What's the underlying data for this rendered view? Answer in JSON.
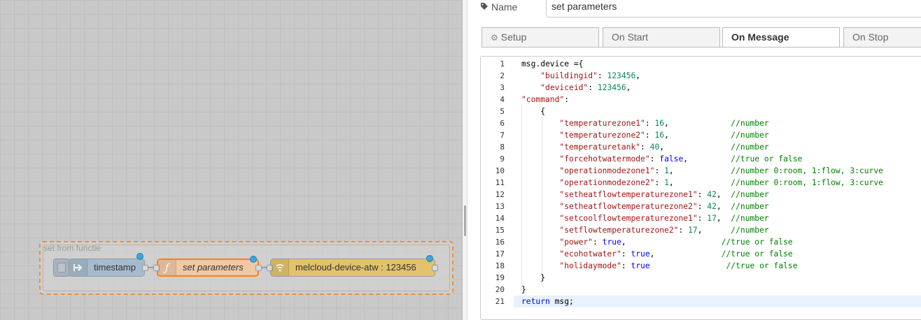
{
  "flow": {
    "group_label": "set from functie",
    "nodes": [
      {
        "label": "timestamp",
        "type": "inject"
      },
      {
        "label": "set parameters",
        "type": "function"
      },
      {
        "label": "melcloud-device-atw : 123456",
        "type": "melcloud"
      }
    ],
    "colors": {
      "inject": "#a6bbcf",
      "function": "#fdd0a2",
      "melcloud": "#e2c26c",
      "group_border": "#e8913b",
      "status_dot": "#3ea7d6"
    }
  },
  "editor": {
    "name_label": "Name",
    "name_value": "set parameters",
    "tabs": [
      {
        "label": "Setup",
        "active": false
      },
      {
        "label": "On Start",
        "active": false
      },
      {
        "label": "On Message",
        "active": true
      },
      {
        "label": "On Stop",
        "active": false
      }
    ],
    "code": {
      "line_numbers": [
        "1",
        "2",
        "3",
        "4",
        "5",
        "6",
        "7",
        "8",
        "9",
        "10",
        "11",
        "12",
        "13",
        "14",
        "15",
        "16",
        "17",
        "18",
        "19",
        "20",
        "21"
      ],
      "lines": [
        [
          {
            "t": "msg.device ={",
            "c": "plain"
          }
        ],
        [
          {
            "t": "    ",
            "c": "plain"
          },
          {
            "t": "\"buildingid\"",
            "c": "str"
          },
          {
            "t": ": ",
            "c": "plain"
          },
          {
            "t": "123456",
            "c": "num"
          },
          {
            "t": ",",
            "c": "plain"
          }
        ],
        [
          {
            "t": "    ",
            "c": "plain"
          },
          {
            "t": "\"deviceid\"",
            "c": "str"
          },
          {
            "t": ": ",
            "c": "plain"
          },
          {
            "t": "123456",
            "c": "num"
          },
          {
            "t": ",",
            "c": "plain"
          }
        ],
        [
          {
            "t": "\"command\"",
            "c": "str"
          },
          {
            "t": ":",
            "c": "plain"
          }
        ],
        [
          {
            "t": "    {",
            "c": "plain"
          }
        ],
        [
          {
            "t": "        ",
            "c": "plain"
          },
          {
            "t": "\"temperaturezone1\"",
            "c": "str"
          },
          {
            "t": ": ",
            "c": "plain"
          },
          {
            "t": "16",
            "c": "num"
          },
          {
            "t": ",             ",
            "c": "plain"
          },
          {
            "t": "//number",
            "c": "com"
          }
        ],
        [
          {
            "t": "        ",
            "c": "plain"
          },
          {
            "t": "\"temperaturezone2\"",
            "c": "str"
          },
          {
            "t": ": ",
            "c": "plain"
          },
          {
            "t": "16",
            "c": "num"
          },
          {
            "t": ",             ",
            "c": "plain"
          },
          {
            "t": "//number",
            "c": "com"
          }
        ],
        [
          {
            "t": "        ",
            "c": "plain"
          },
          {
            "t": "\"temperaturetank\"",
            "c": "str"
          },
          {
            "t": ": ",
            "c": "plain"
          },
          {
            "t": "40",
            "c": "num"
          },
          {
            "t": ",              ",
            "c": "plain"
          },
          {
            "t": "//number",
            "c": "com"
          }
        ],
        [
          {
            "t": "        ",
            "c": "plain"
          },
          {
            "t": "\"forcehotwatermode\"",
            "c": "str"
          },
          {
            "t": ": ",
            "c": "plain"
          },
          {
            "t": "false",
            "c": "kw"
          },
          {
            "t": ",         ",
            "c": "plain"
          },
          {
            "t": "//true or false",
            "c": "com"
          }
        ],
        [
          {
            "t": "        ",
            "c": "plain"
          },
          {
            "t": "\"operationmodezone1\"",
            "c": "str"
          },
          {
            "t": ": ",
            "c": "plain"
          },
          {
            "t": "1",
            "c": "num"
          },
          {
            "t": ",            ",
            "c": "plain"
          },
          {
            "t": "//number 0:room, 1:flow, 3:curve",
            "c": "com"
          }
        ],
        [
          {
            "t": "        ",
            "c": "plain"
          },
          {
            "t": "\"operationmodezone2\"",
            "c": "str"
          },
          {
            "t": ": ",
            "c": "plain"
          },
          {
            "t": "1",
            "c": "num"
          },
          {
            "t": ",            ",
            "c": "plain"
          },
          {
            "t": "//number 0:room, 1:flow, 3:curve",
            "c": "com"
          }
        ],
        [
          {
            "t": "        ",
            "c": "plain"
          },
          {
            "t": "\"setheatflowtemperaturezone1\"",
            "c": "str"
          },
          {
            "t": ": ",
            "c": "plain"
          },
          {
            "t": "42",
            "c": "num"
          },
          {
            "t": ",  ",
            "c": "plain"
          },
          {
            "t": "//number",
            "c": "com"
          }
        ],
        [
          {
            "t": "        ",
            "c": "plain"
          },
          {
            "t": "\"setheatflowtemperaturezone2\"",
            "c": "str"
          },
          {
            "t": ": ",
            "c": "plain"
          },
          {
            "t": "42",
            "c": "num"
          },
          {
            "t": ",  ",
            "c": "plain"
          },
          {
            "t": "//number",
            "c": "com"
          }
        ],
        [
          {
            "t": "        ",
            "c": "plain"
          },
          {
            "t": "\"setcoolflowtemperaturezone1\"",
            "c": "str"
          },
          {
            "t": ": ",
            "c": "plain"
          },
          {
            "t": "17",
            "c": "num"
          },
          {
            "t": ",  ",
            "c": "plain"
          },
          {
            "t": "//number",
            "c": "com"
          }
        ],
        [
          {
            "t": "        ",
            "c": "plain"
          },
          {
            "t": "\"setflowtemperaturezone2\"",
            "c": "str"
          },
          {
            "t": ": ",
            "c": "plain"
          },
          {
            "t": "17",
            "c": "num"
          },
          {
            "t": ",      ",
            "c": "plain"
          },
          {
            "t": "//number",
            "c": "com"
          }
        ],
        [
          {
            "t": "        ",
            "c": "plain"
          },
          {
            "t": "\"power\"",
            "c": "str"
          },
          {
            "t": ": ",
            "c": "plain"
          },
          {
            "t": "true",
            "c": "kw"
          },
          {
            "t": ",                    ",
            "c": "plain"
          },
          {
            "t": "//true or false",
            "c": "com"
          }
        ],
        [
          {
            "t": "        ",
            "c": "plain"
          },
          {
            "t": "\"ecohotwater\"",
            "c": "str"
          },
          {
            "t": ": ",
            "c": "plain"
          },
          {
            "t": "true",
            "c": "kw"
          },
          {
            "t": ",              ",
            "c": "plain"
          },
          {
            "t": "//true or false",
            "c": "com"
          }
        ],
        [
          {
            "t": "        ",
            "c": "plain"
          },
          {
            "t": "\"holidaymode\"",
            "c": "str"
          },
          {
            "t": ": ",
            "c": "plain"
          },
          {
            "t": "true",
            "c": "kw"
          },
          {
            "t": "                ",
            "c": "plain"
          },
          {
            "t": "//true or false",
            "c": "com"
          }
        ],
        [
          {
            "t": "    }",
            "c": "plain"
          }
        ],
        [
          {
            "t": "}",
            "c": "plain"
          }
        ],
        [
          {
            "t": "return",
            "c": "kw"
          },
          {
            "t": " msg;",
            "c": "plain"
          }
        ]
      ],
      "colors": {
        "plain": "#000000",
        "str": "#a31515",
        "num": "#098658",
        "kw": "#0000ff",
        "com": "#008000"
      }
    }
  }
}
